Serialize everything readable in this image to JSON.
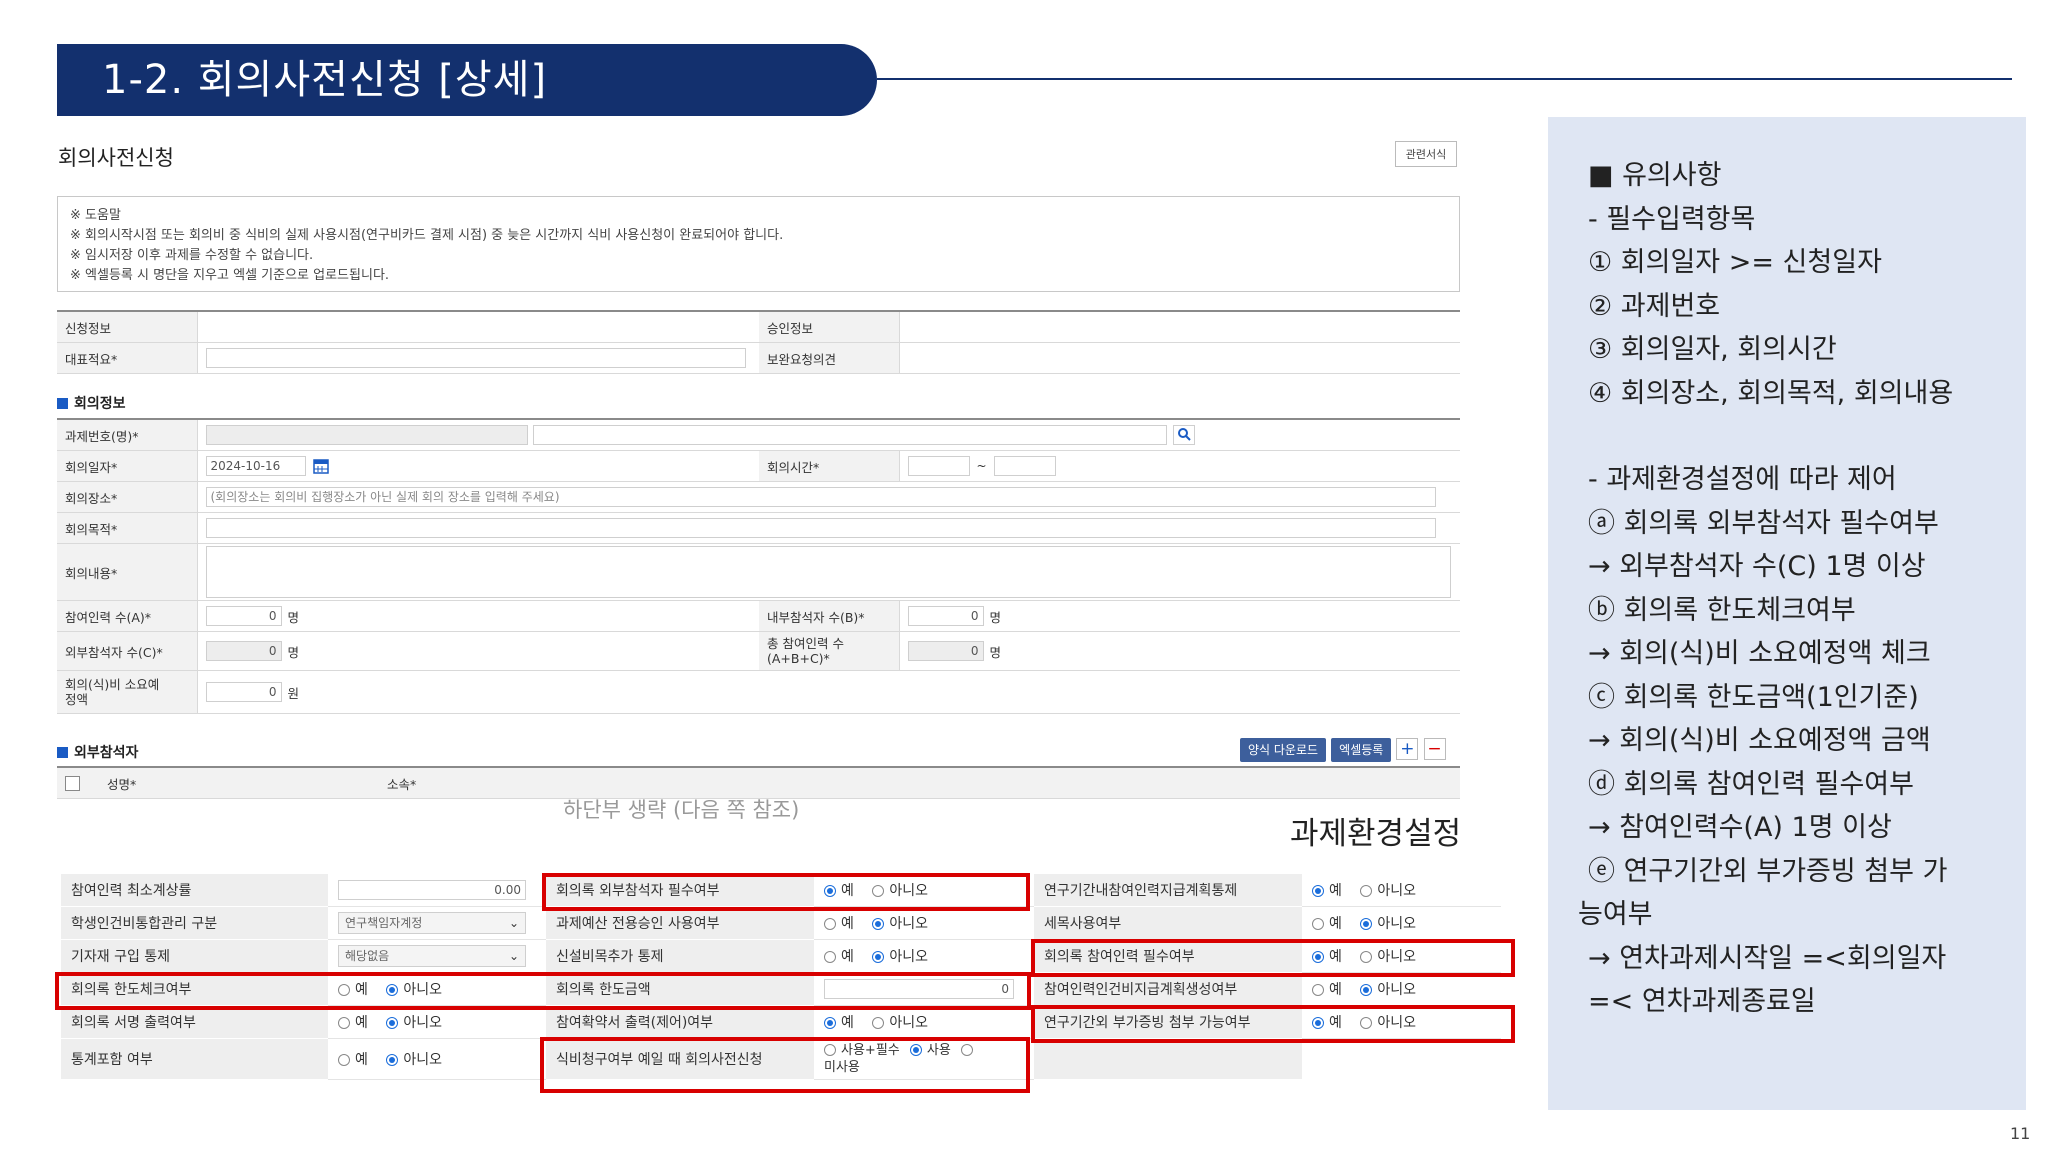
{
  "header": {
    "title": "1-2. 회의사전신청 [상세]"
  },
  "form": {
    "title": "회의사전신청",
    "ref_button": "관련서식",
    "help": [
      "※ 도움말",
      "※ 회의시작시점 또는 회의비 중 식비의 실제 사용시점(연구비카드 결제 시점) 중 늦은 시간까지 식비 사용신청이 완료되어야 합니다.",
      "※ 임시저장 이후 과제를 수정할 수 없습니다.",
      "※ 엑셀등록 시 명단을 지우고 엑셀 기준으로 업로드됩니다."
    ],
    "apply_info_label": "신청정보",
    "approve_info_label": "승인정보",
    "rep_label": "대표적요*",
    "supp_label": "보완요청의견",
    "meeting_section": "회의정보",
    "project_label": "과제번호(명)*",
    "date_label": "회의일자*",
    "date_value": "2024-10-16",
    "time_label": "회의시간*",
    "time_sep": "~",
    "place_label": "회의장소*",
    "place_placeholder": "(회의장소는 회의비 집행장소가 아닌 실제 회의 장소를 입력해 주세요)",
    "purpose_label": "회의목적*",
    "content_label": "회의내용*",
    "count_a_label": "참여인력 수(A)*",
    "count_a_value": "0",
    "count_b_label": "내부참석자 수(B)*",
    "count_b_value": "0",
    "count_c_label": "외부참석자 수(C)*",
    "count_c_value": "0",
    "count_total_label_1": "총 참여인력 수",
    "count_total_label_2": "(A+B+C)*",
    "count_total_value": "0",
    "budget_label_1": "회의(식)비 소요예",
    "budget_label_2": "정액",
    "budget_value": "0",
    "unit_person": "명",
    "unit_won": "원",
    "external_section": "외부참석자",
    "download_btn": "양식 다운로드",
    "excel_btn": "엑셀등록",
    "add_btn": "+",
    "remove_btn": "−",
    "col_name": "성명*",
    "col_org": "소속*"
  },
  "skip_note": "하단부 생략 (다음 쪽 참조)",
  "env_title": "과제환경설정",
  "env": {
    "yes": "예",
    "no": "아니오",
    "rows": [
      {
        "l1": "참여인력 최소계상률",
        "v1_input": "0.00",
        "l2": "회의록 외부참석자 필수여부",
        "v2_radio": "yes",
        "l3": "연구기간내참여인력지급계획통제",
        "v3_radio": "yes"
      },
      {
        "l1": "학생인건비통합관리 구분",
        "v1_select": "연구책임자계정",
        "l2": "과제예산 전용승인 사용여부",
        "v2_radio": "no",
        "l3": "세목사용여부",
        "v3_radio": "no"
      },
      {
        "l1": "기자재 구입 통제",
        "v1_select": "해당없음",
        "l2": "신설비목추가 통제",
        "v2_radio": "no",
        "l3": "회의록 참여인력 필수여부",
        "v3_radio": "yes"
      },
      {
        "l1": "회의록 한도체크여부",
        "v1_radio": "no",
        "l2": "회의록 한도금액",
        "v2_input": "0",
        "l3": "참여인력인건비지급계획생성여부",
        "v3_radio": "no"
      },
      {
        "l1": "회의록 서명 출력여부",
        "v1_radio": "no",
        "l2": "참여확약서 출력(제어)여부",
        "v2_radio": "yes",
        "l3": "연구기간외 부가증빙 첨부 가능여부",
        "v3_radio": "yes"
      },
      {
        "l1": "통계포함 여부",
        "v1_radio": "no",
        "l2": "식비청구여부 예일 때 회의사전신청",
        "v2_opts": [
          "사용+필수",
          "사용",
          "미사용"
        ],
        "v2_selected": "사용"
      }
    ]
  },
  "notes": {
    "lines": [
      "■ 유의사항",
      "- 필수입력항목",
      " ① 회의일자 >= 신청일자",
      " ② 과제번호",
      " ③ 회의일자, 회의시간",
      " ④ 회의장소, 회의목적, 회의내용",
      "",
      "- 과제환경설정에 따라 제어",
      " ⓐ 회의록 외부참석자 필수여부",
      "   → 외부참석자 수(C) 1명 이상",
      " ⓑ 회의록 한도체크여부",
      "   → 회의(식)비 소요예정액 체크",
      " ⓒ 회의록 한도금액(1인기준)",
      "   → 회의(식)비 소요예정액 금액",
      " ⓓ 회의록 참여인력 필수여부",
      "   → 참여인력수(A) 1명 이상",
      " ⓔ 연구기간외 부가증빙 첨부 가",
      "능여부",
      "   → 연차과제시작일 =<회의일자",
      "    =< 연차과제종료일"
    ]
  },
  "page_number": "11",
  "colors": {
    "banner": "#13306e",
    "highlight": "#d80000",
    "notes_bg": "#dfe6f3",
    "radio_on": "#1a6ddb"
  }
}
